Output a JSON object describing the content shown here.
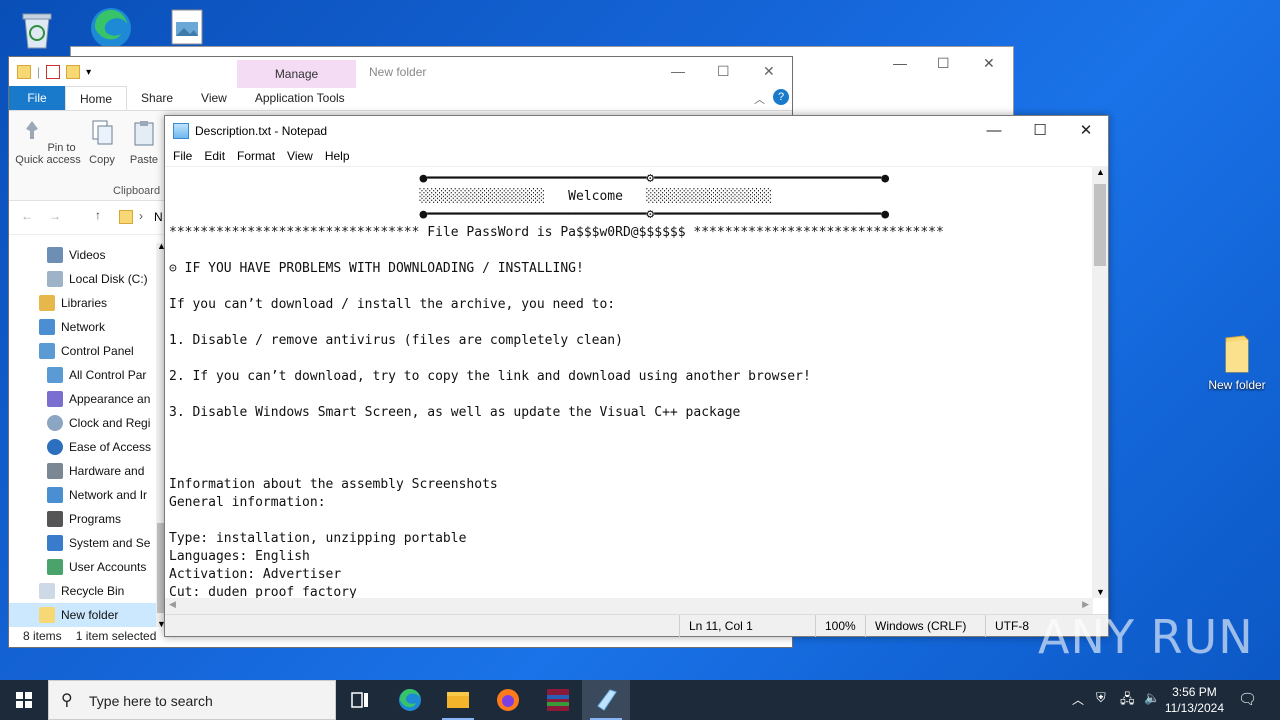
{
  "desktop": {
    "icons": [
      {
        "label": "",
        "icon": "recycle-bin-icon"
      },
      {
        "label": "",
        "icon": "edge-icon"
      },
      {
        "label": "",
        "icon": "image-file-icon"
      },
      {
        "label": "New folder",
        "icon": "folder-icon"
      }
    ]
  },
  "explorer": {
    "manage_tab": "Manage",
    "title": "New folder",
    "tabs": [
      "File",
      "Home",
      "Share",
      "View",
      "Application Tools"
    ],
    "ribbon": {
      "pin_label": "Pin to Quick access",
      "copy_label": "Copy",
      "paste_label": "Paste",
      "group_label": "Clipboard"
    },
    "address_text": "N",
    "nav_items": [
      {
        "label": "Videos"
      },
      {
        "label": "Local Disk (C:)"
      },
      {
        "label": "Libraries"
      },
      {
        "label": "Network"
      },
      {
        "label": "Control Panel"
      },
      {
        "label": "All Control Par"
      },
      {
        "label": "Appearance an"
      },
      {
        "label": "Clock and Regi"
      },
      {
        "label": "Ease of Access"
      },
      {
        "label": "Hardware and"
      },
      {
        "label": "Network and Ir"
      },
      {
        "label": "Programs"
      },
      {
        "label": "System and Se"
      },
      {
        "label": "User Accounts"
      },
      {
        "label": "Recycle Bin"
      },
      {
        "label": "New folder"
      }
    ],
    "status": {
      "items": "8 items",
      "selected": "1 item selected"
    }
  },
  "notepad": {
    "title": "Description.txt - Notepad",
    "menu": [
      "File",
      "Edit",
      "Format",
      "View",
      "Help"
    ],
    "content": "                                ●━━━━━━━━━━━━━━━━━━━━━━━━━━━━⚙━━━━━━━━━━━━━━━━━━━━━━━━━━━━━●\n                                ░░░░░░░░░░░░░░░░   Welcome   ░░░░░░░░░░░░░░░░\n                                ●━━━━━━━━━━━━━━━━━━━━━━━━━━━━⚙━━━━━━━━━━━━━━━━━━━━━━━━━━━━━●\n******************************** File PassWord is Pa$$$w0RD@$$$$$$ ********************************\n\n⊝ IF YOU HAVE PROBLEMS WITH DOWNLOADING / INSTALLING!\n\nIf you can’t download / install the archive, you need to:\n\n1. Disable / remove antivirus (files are completely clean)\n\n2. If you can’t download, try to copy the link and download using another browser!\n\n3. Disable Windows Smart Screen, as well as update the Visual C++ package\n\n\n\nInformation about the assembly Screenshots\nGeneral information:\n\nType: installation, unzipping portable\nLanguages: English\nActivation: Advertiser\nCut: duden proof factory",
    "status": {
      "position": "Ln 11, Col 1",
      "zoom": "100%",
      "eol": "Windows (CRLF)",
      "encoding": "UTF-8"
    }
  },
  "taskbar": {
    "search_placeholder": "Type here to search",
    "time": "3:56 PM",
    "date": "11/13/2024"
  },
  "watermark": "ANY RUN"
}
